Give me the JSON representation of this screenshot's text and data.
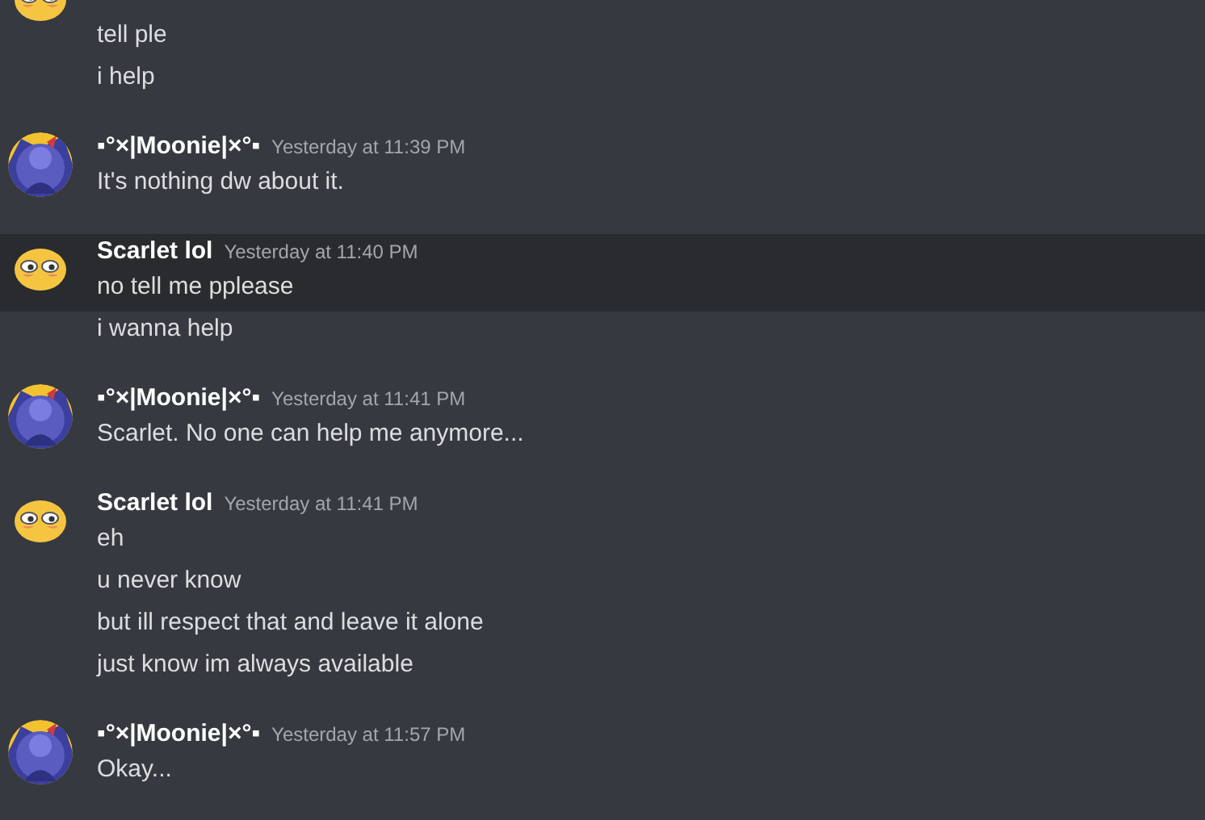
{
  "groups": [
    {
      "kind": "emoji",
      "messages": [
        {
          "text": "tell ple",
          "hovered": false
        },
        {
          "text": "i help",
          "hovered": false
        }
      ]
    },
    {
      "kind": "character",
      "author": "▪°×|Moonie|×°▪",
      "timestamp": "Yesterday at 11:39 PM",
      "messages": [
        {
          "text": "It's nothing dw about it.",
          "hovered": false
        }
      ]
    },
    {
      "kind": "emoji",
      "author": "Scarlet lol",
      "timestamp": "Yesterday at 11:40 PM",
      "messages": [
        {
          "text": "no tell me pplease",
          "hovered": true
        },
        {
          "text": "i wanna help",
          "hovered": false
        }
      ]
    },
    {
      "kind": "character",
      "author": "▪°×|Moonie|×°▪",
      "timestamp": "Yesterday at 11:41 PM",
      "messages": [
        {
          "text": "Scarlet. No one can help me anymore...",
          "hovered": false
        }
      ]
    },
    {
      "kind": "emoji",
      "author": "Scarlet lol",
      "timestamp": "Yesterday at 11:41 PM",
      "messages": [
        {
          "text": "eh",
          "hovered": false
        },
        {
          "text": "u never know",
          "hovered": false
        },
        {
          "text": "but ill respect that and leave it alone",
          "hovered": false
        },
        {
          "text": "just know im always available",
          "hovered": false
        }
      ]
    },
    {
      "kind": "character",
      "author": "▪°×|Moonie|×°▪",
      "timestamp": "Yesterday at 11:57 PM",
      "messages": [
        {
          "text": "Okay...",
          "hovered": false
        }
      ]
    }
  ]
}
